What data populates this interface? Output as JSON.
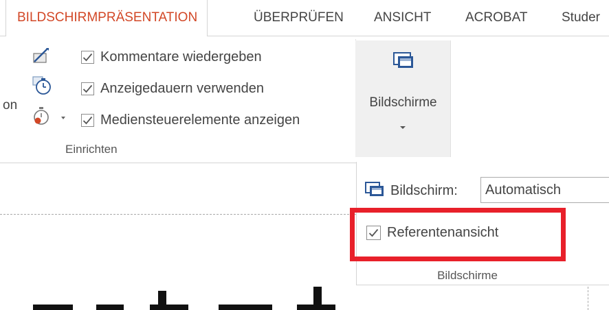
{
  "tabs": [
    {
      "label": "BILDSCHIRMPRÄSENTATION",
      "active": true
    },
    {
      "label": "ÜBERPRÜFEN",
      "active": false
    },
    {
      "label": "ANSICHT",
      "active": false
    },
    {
      "label": "ACROBAT",
      "active": false
    },
    {
      "label": "Studer",
      "active": false
    }
  ],
  "ribbon": {
    "cut_off_text": "on",
    "setup_group": {
      "label": "Einrichten",
      "options": [
        {
          "label": "Kommentare wiedergeben",
          "checked": true,
          "icon": "pen-annotation-icon"
        },
        {
          "label": "Anzeigedauern verwenden",
          "checked": true,
          "icon": "timer-icon"
        },
        {
          "label": "Mediensteuerelemente anzeigen",
          "checked": true,
          "icon": "media-stopwatch-icon"
        }
      ]
    },
    "monitors_button": {
      "label": "Bildschirme",
      "icon": "monitors-icon"
    }
  },
  "monitors_panel": {
    "monitor_label": "Bildschirm:",
    "monitor_value": "Automatisch",
    "presenter_view_label": "Referentenansicht",
    "presenter_view_checked": true,
    "group_label": "Bildschirme"
  },
  "colors": {
    "active_tab": "#d24726",
    "highlight": "#e8202a",
    "text": "#444444",
    "icon_blue": "#2b5797"
  }
}
